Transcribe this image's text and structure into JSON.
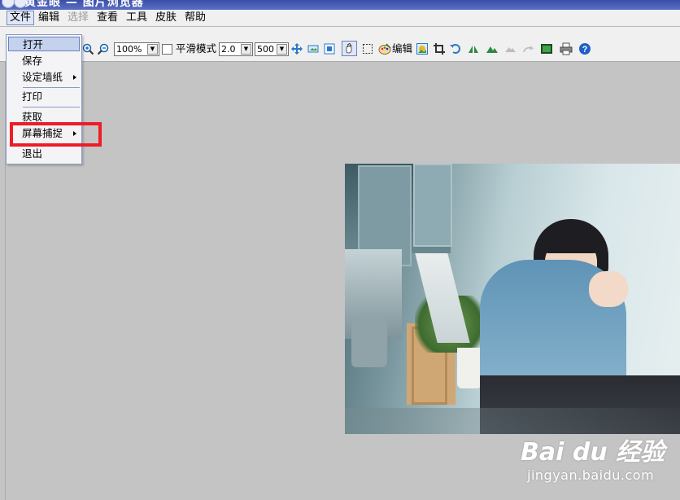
{
  "window": {
    "title": "黄金眼 — 图片浏览器"
  },
  "menubar": {
    "items": [
      {
        "label": "文件",
        "state": "active"
      },
      {
        "label": "编辑",
        "state": "normal"
      },
      {
        "label": "选择",
        "state": "disabled"
      },
      {
        "label": "查看",
        "state": "normal"
      },
      {
        "label": "工具",
        "state": "normal"
      },
      {
        "label": "皮肤",
        "state": "normal"
      },
      {
        "label": "帮助",
        "state": "normal"
      }
    ]
  },
  "toolbar": {
    "zoom_value": "100%",
    "smooth_mode_label": "平滑模式",
    "smooth_mode_checked": false,
    "scale_value": "2.0",
    "size_value": "500",
    "edit_label": "编辑"
  },
  "file_menu": {
    "items": [
      {
        "label": "打开",
        "highlight": true,
        "submenu": false
      },
      {
        "label": "保存",
        "highlight": false,
        "submenu": false
      },
      {
        "label": "设定墙纸",
        "highlight": false,
        "submenu": true
      },
      {
        "label": "打印",
        "highlight": false,
        "submenu": false
      },
      {
        "label": "获取",
        "highlight": false,
        "submenu": false
      },
      {
        "label": "屏幕捕捉",
        "highlight": false,
        "submenu": true
      },
      {
        "label": "退出",
        "highlight": false,
        "submenu": false
      }
    ]
  },
  "watermark": {
    "logo": "Bai du 经验",
    "url": "jingyan.baidu.com"
  },
  "colors": {
    "accent": "#ee1c25",
    "titlebar": "#3a4fa8",
    "workspace": "#c4c4c4"
  }
}
